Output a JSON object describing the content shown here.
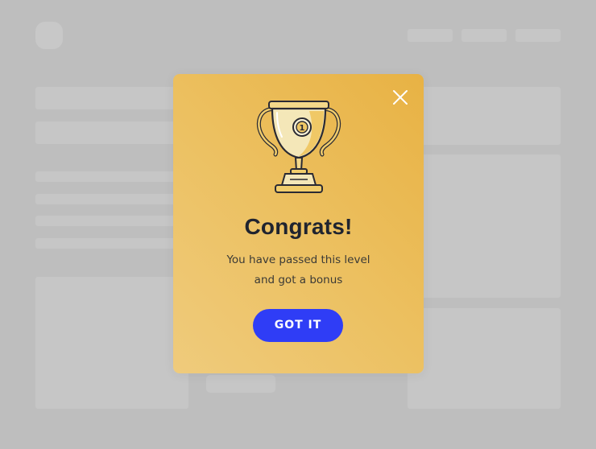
{
  "modal": {
    "title": "Congrats!",
    "message_line1": "You have passed this level",
    "message_line2": "and got a bonus",
    "button_label": "GOT IT",
    "trophy_badge": "1"
  },
  "icons": {
    "close": "close-icon",
    "trophy": "trophy-icon"
  },
  "colors": {
    "modal_gradient_start": "#e8b244",
    "modal_gradient_end": "#efcb7c",
    "button": "#2f3df6",
    "backdrop": "#bebebe"
  }
}
